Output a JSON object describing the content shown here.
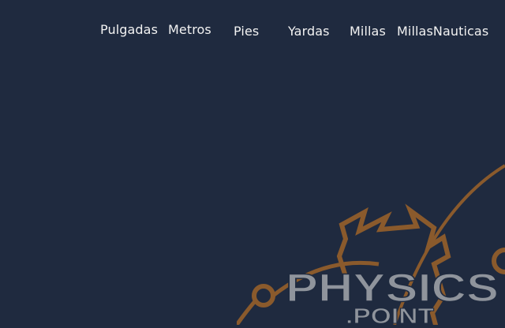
{
  "nav": {
    "items": [
      {
        "label": "Pulgadas"
      },
      {
        "label": "Metros"
      },
      {
        "label": "Pies"
      },
      {
        "label": "Yardas"
      },
      {
        "label": "Millas"
      },
      {
        "label": "MillasNauticas"
      }
    ]
  },
  "logo": {
    "line1": "PHYSICS",
    "line2": ".POINT"
  },
  "colors": {
    "background": "#1f2a3f",
    "nav_text": "#f2f2f2",
    "logo_orange": "#8a5a2c",
    "logo_text": "#8f949c"
  }
}
